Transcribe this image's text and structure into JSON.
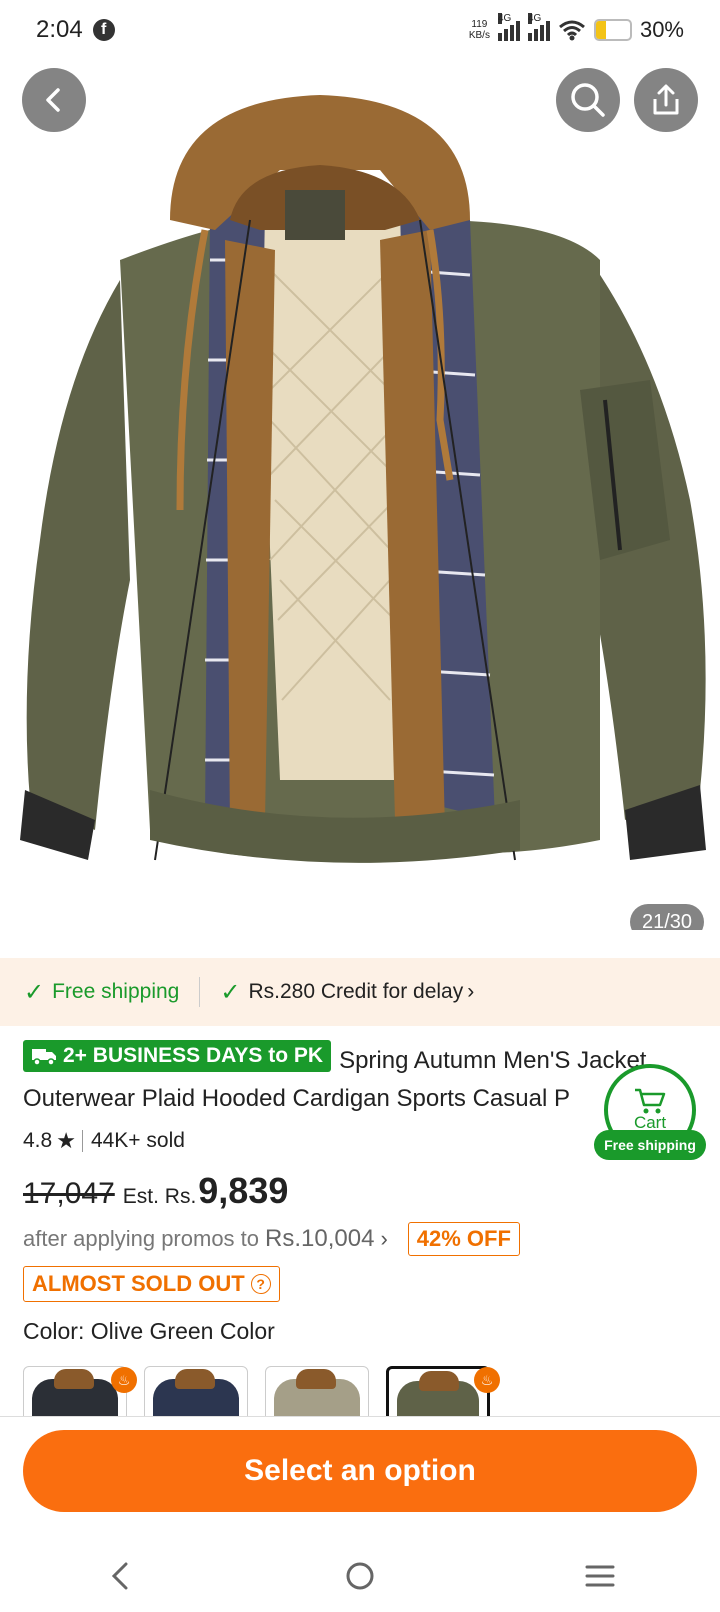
{
  "status_bar": {
    "time": "2:04",
    "network_speed_value": "119",
    "network_speed_unit": "KB/s",
    "network_type_1": "4G",
    "network_type_2": "4G",
    "battery_percent": "30%",
    "battery_level": 0.3,
    "notification_icon": "facebook-icon"
  },
  "hero": {
    "image_counter": "21/30",
    "back_icon": "chevron-left-icon",
    "search_icon": "search-icon",
    "share_icon": "share-icon"
  },
  "shipping_strip": {
    "free_shipping": "Free shipping",
    "credit": "Rs.280 Credit for delay"
  },
  "product": {
    "delivery_badge": "2+ BUSINESS DAYS to PK",
    "title_line1": "Spring Autumn Men'S Jacket",
    "title_line2": "Outerwear Plaid Hooded Cardigan Sports Casual P",
    "rating": "4.8",
    "sold": "44K+ sold",
    "original_price": "17,047",
    "est_label": "Est. Rs.",
    "current_price": "9,839",
    "promo_text": "after applying promos to",
    "promo_price": "Rs.10,004",
    "discount": "42% OFF",
    "stock_notice": "ALMOST SOLD OUT",
    "color_label": "Color: Olive Green Color"
  },
  "cart_float": {
    "label": "Cart",
    "shipping": "Free shipping"
  },
  "swatches": [
    {
      "name": "Black",
      "color": "#2b2f36",
      "hot": true,
      "selected": false
    },
    {
      "name": "Navy",
      "color": "#2c3650",
      "hot": false,
      "selected": false
    },
    {
      "name": "Khaki",
      "color": "#a59f88",
      "hot": false,
      "selected": false
    },
    {
      "name": "Olive Green",
      "color": "#5f6248",
      "hot": true,
      "selected": true
    }
  ],
  "cta": {
    "label": "Select an option"
  },
  "colors": {
    "brand_orange": "#fa6e0f",
    "ship_green": "#1a9a2b",
    "jacket_olive": "#5f6248",
    "jacket_brown": "#9a6a34"
  }
}
